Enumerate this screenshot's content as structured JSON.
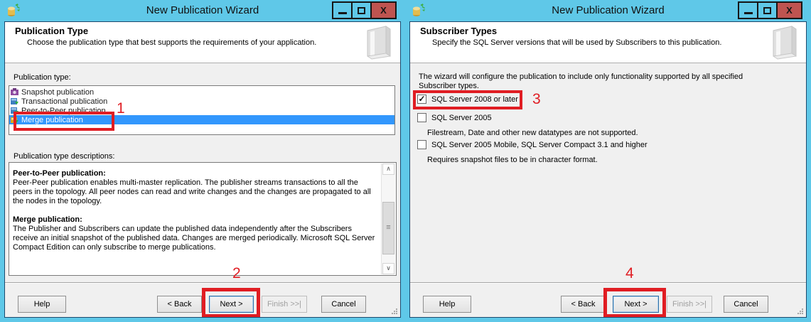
{
  "colors": {
    "titlebar": "#5fc8e8",
    "close_button": "#bf5450",
    "selection_blue": "#3297fd",
    "annotation_red": "#e01d23",
    "dialog_background": "#f0f0f0"
  },
  "icons": {
    "close": "X",
    "scroll_up": "∧",
    "scroll_down": "∨",
    "grip": "≡",
    "check": "✓"
  },
  "window_left": {
    "title": "New Publication Wizard",
    "heading": "Publication Type",
    "subheading": "Choose the publication type that best supports the requirements of your application.",
    "list_label": "Publication type:",
    "list_items": [
      {
        "label": "Snapshot publication",
        "selected": false
      },
      {
        "label": "Transactional publication",
        "selected": false
      },
      {
        "label": "Peer-to-Peer publication",
        "selected": false
      },
      {
        "label": "Merge publication",
        "selected": true
      }
    ],
    "desc_label": "Publication type descriptions:",
    "descriptions": [
      {
        "title": "Peer-to-Peer publication:",
        "body": "Peer-Peer publication enables multi-master replication. The publisher streams transactions to all the peers in the topology. All peer nodes can read and write changes and the changes are propagated to all the nodes in the topology."
      },
      {
        "title": "Merge publication:",
        "body": "The Publisher and Subscribers can update the published data independently after the Subscribers receive an initial snapshot of the published data. Changes are merged periodically. Microsoft SQL Server Compact Edition can only subscribe to merge publications."
      }
    ],
    "buttons": {
      "help": "Help",
      "back": "< Back",
      "next": "Next >",
      "finish": "Finish >>|",
      "cancel": "Cancel"
    },
    "annotations": {
      "list_step": "1",
      "next_step": "2"
    }
  },
  "window_right": {
    "title": "New Publication Wizard",
    "heading": "Subscriber Types",
    "subheading": "Specify the SQL Server versions that will be used by Subscribers to this publication.",
    "intro": "The wizard will configure the publication to include only functionality supported by all specified Subscriber types.",
    "checkboxes": [
      {
        "label": "SQL Server 2008 or later",
        "checked": true,
        "note": ""
      },
      {
        "label": "SQL Server 2005",
        "checked": false,
        "note": "Filestream, Date and other new datatypes are not supported."
      },
      {
        "label": "SQL Server 2005 Mobile, SQL Server Compact 3.1 and higher",
        "checked": false,
        "note": "Requires snapshot files to be in character format."
      }
    ],
    "buttons": {
      "help": "Help",
      "back": "< Back",
      "next": "Next >",
      "finish": "Finish >>|",
      "cancel": "Cancel"
    },
    "annotations": {
      "checkbox_step": "3",
      "next_step": "4"
    }
  }
}
